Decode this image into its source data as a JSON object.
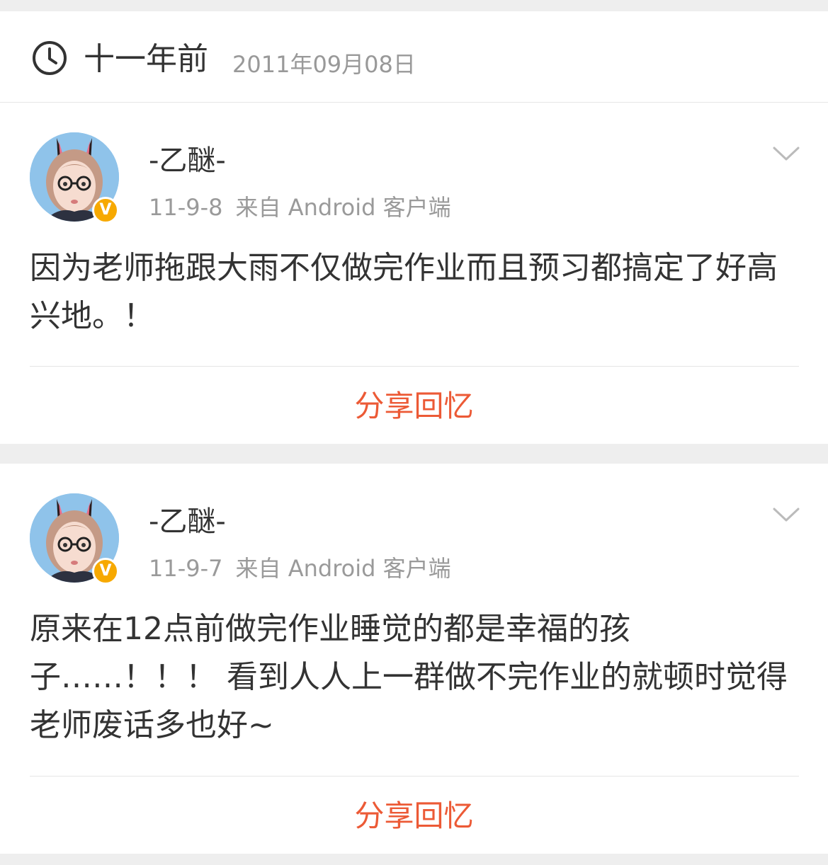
{
  "header": {
    "icon": "clock-icon",
    "title": "十一年前",
    "date": "2011年09月08日"
  },
  "posts": [
    {
      "username": "-乙醚-",
      "time": "11-9-8",
      "source": "来自 Android 客户端",
      "text": "因为老师拖跟大雨不仅做完作业而且预习都搞定了好高兴地。！",
      "badge": "V",
      "share_label": "分享回忆"
    },
    {
      "username": "-乙醚-",
      "time": "11-9-7",
      "source": "来自 Android 客户端",
      "text": "原来在12点前做完作业睡觉的都是幸福的孩子……！！！ 看到人人上一群做不完作业的就顿时觉得老师废话多也好~",
      "badge": "V",
      "share_label": "分享回忆"
    }
  ],
  "colors": {
    "accent": "#ec5a36",
    "badge": "#f7a900",
    "text": "#333333",
    "muted": "#999999"
  }
}
